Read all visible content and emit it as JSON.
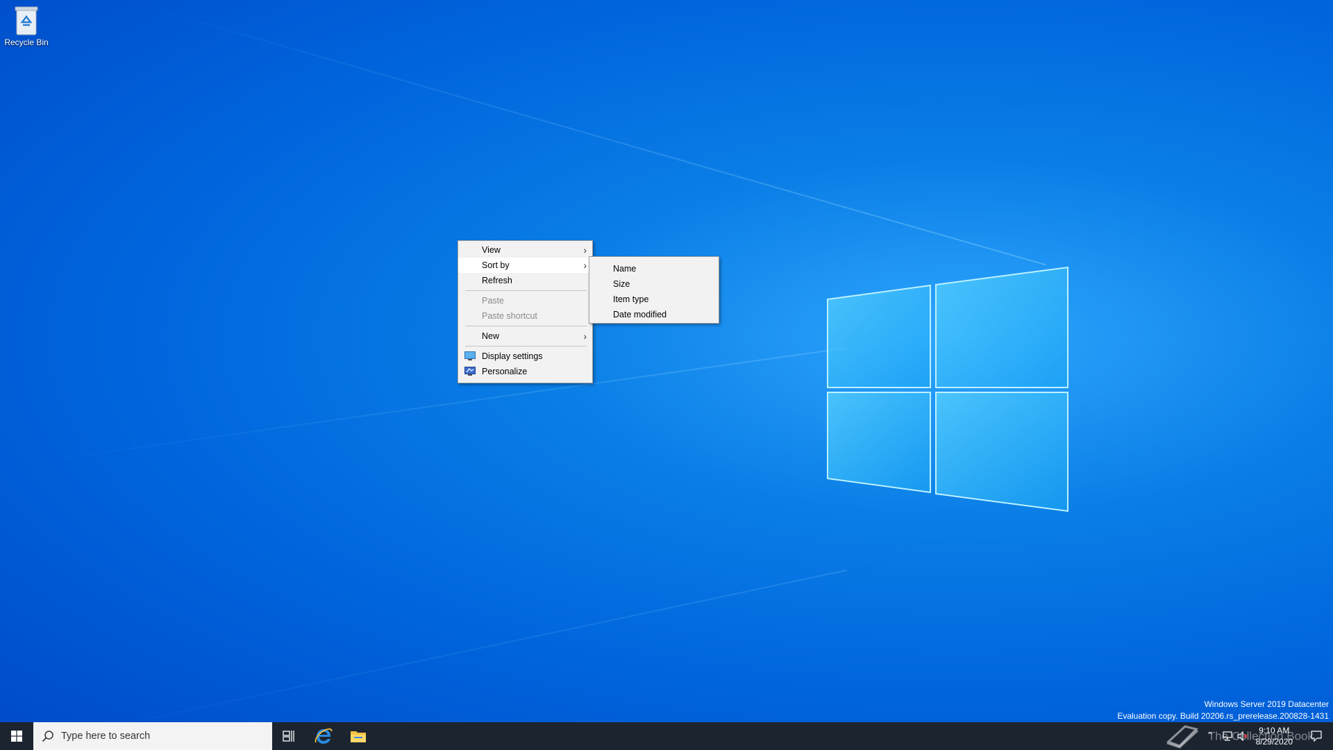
{
  "desktop": {
    "icons": [
      {
        "label": "Recycle Bin",
        "icon": "recycle-bin-icon"
      }
    ]
  },
  "context_menu": {
    "items": [
      {
        "label": "View",
        "has_submenu": true,
        "enabled": true
      },
      {
        "label": "Sort by",
        "has_submenu": true,
        "enabled": true,
        "highlighted": true
      },
      {
        "label": "Refresh",
        "enabled": true
      },
      {
        "label": "Paste",
        "enabled": false
      },
      {
        "label": "Paste shortcut",
        "enabled": false
      },
      {
        "label": "New",
        "has_submenu": true,
        "enabled": true
      },
      {
        "label": "Display settings",
        "icon": "display-settings-icon",
        "enabled": true
      },
      {
        "label": "Personalize",
        "icon": "personalize-icon",
        "enabled": true
      }
    ]
  },
  "sortby_submenu": {
    "items": [
      {
        "label": "Name"
      },
      {
        "label": "Size"
      },
      {
        "label": "Item type"
      },
      {
        "label": "Date modified"
      }
    ]
  },
  "watermark": {
    "line1": "Windows Server 2019 Datacenter",
    "line2": "Evaluation copy. Build 20206.rs_prerelease.200828-1431"
  },
  "taskbar": {
    "search_placeholder": "Type here to search",
    "pinned": [
      "task-view-icon",
      "internet-explorer-icon",
      "file-explorer-icon"
    ],
    "clock_time": "9:10 AM",
    "clock_date": "8/29/2020",
    "overlay_text": "The Collection Book"
  },
  "colors": {
    "taskbar_bg": "#1c2430",
    "menu_bg": "#f2f2f2",
    "desktop_accent": "#0078d7"
  }
}
